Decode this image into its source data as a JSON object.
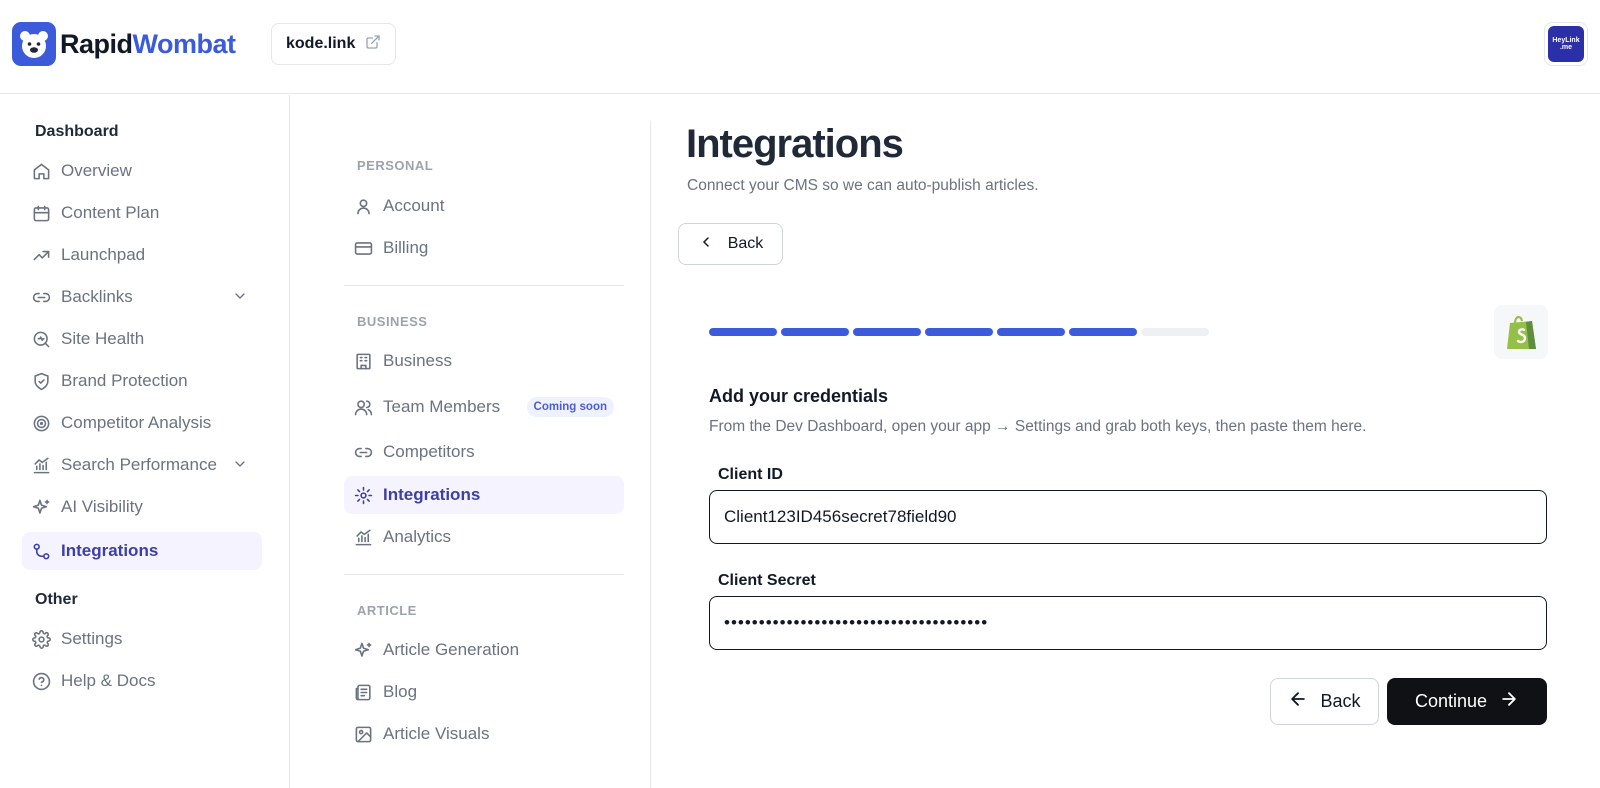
{
  "brand": {
    "name_part1": "Rapid",
    "name_part2": "Wombat",
    "icon": "wombat-logo-icon",
    "accent": "#3b5bdb"
  },
  "header": {
    "site": "kode.link",
    "site_icon": "external-link-icon",
    "avatar_text_top": "HeyLink",
    "avatar_text_bottom": ".me"
  },
  "sidebar": {
    "section_dashboard": "Dashboard",
    "items": [
      {
        "label": "Overview",
        "icon": "home-icon"
      },
      {
        "label": "Content Plan",
        "icon": "calendar-icon"
      },
      {
        "label": "Launchpad",
        "icon": "trending-up-icon"
      },
      {
        "label": "Backlinks",
        "icon": "link-icon",
        "expandable": true
      },
      {
        "label": "Site Health",
        "icon": "search-health-icon"
      },
      {
        "label": "Brand Protection",
        "icon": "shield-icon"
      },
      {
        "label": "Competitor Analysis",
        "icon": "target-icon"
      },
      {
        "label": "Search Performance",
        "icon": "bar-chart-icon",
        "expandable": true
      },
      {
        "label": "AI Visibility",
        "icon": "sparkles-icon"
      },
      {
        "label": "Integrations",
        "icon": "git-merge-icon",
        "active": true
      }
    ],
    "section_other": "Other",
    "other_items": [
      {
        "label": "Settings",
        "icon": "gear-icon"
      },
      {
        "label": "Help & Docs",
        "icon": "help-circle-icon"
      }
    ]
  },
  "subnav": {
    "personal_title": "PERSONAL",
    "personal": [
      {
        "label": "Account",
        "icon": "user-icon"
      },
      {
        "label": "Billing",
        "icon": "credit-card-icon"
      }
    ],
    "business_title": "BUSINESS",
    "business": [
      {
        "label": "Business",
        "icon": "building-icon"
      },
      {
        "label": "Team Members",
        "icon": "users-icon",
        "badge": "Coming soon"
      },
      {
        "label": "Competitors",
        "icon": "link-icon"
      },
      {
        "label": "Integrations",
        "icon": "gear-icon",
        "active": true
      },
      {
        "label": "Analytics",
        "icon": "bar-chart-icon"
      }
    ],
    "article_title": "ARTICLE",
    "article": [
      {
        "label": "Article Generation",
        "icon": "sparkles-icon"
      },
      {
        "label": "Blog",
        "icon": "newspaper-icon"
      },
      {
        "label": "Article Visuals",
        "icon": "image-icon"
      }
    ]
  },
  "main": {
    "title": "Integrations",
    "subtitle": "Connect your CMS so we can auto-publish articles.",
    "back_label": "Back",
    "progress": {
      "completed_steps": 6,
      "total_steps": 7
    },
    "cms_icon": "shopify-bag-icon",
    "cred_title": "Add your credentials",
    "cred_subtitle": "From the Dev Dashboard, open your app → Settings and grab both keys, then paste them here.",
    "client_id_label": "Client ID",
    "client_id_value": "Client123ID456secret78field90",
    "client_secret_label": "Client Secret",
    "client_secret_value": "••••••••••••••••••••••••••••••••••••••",
    "back_button": "Back",
    "continue_button": "Continue"
  }
}
